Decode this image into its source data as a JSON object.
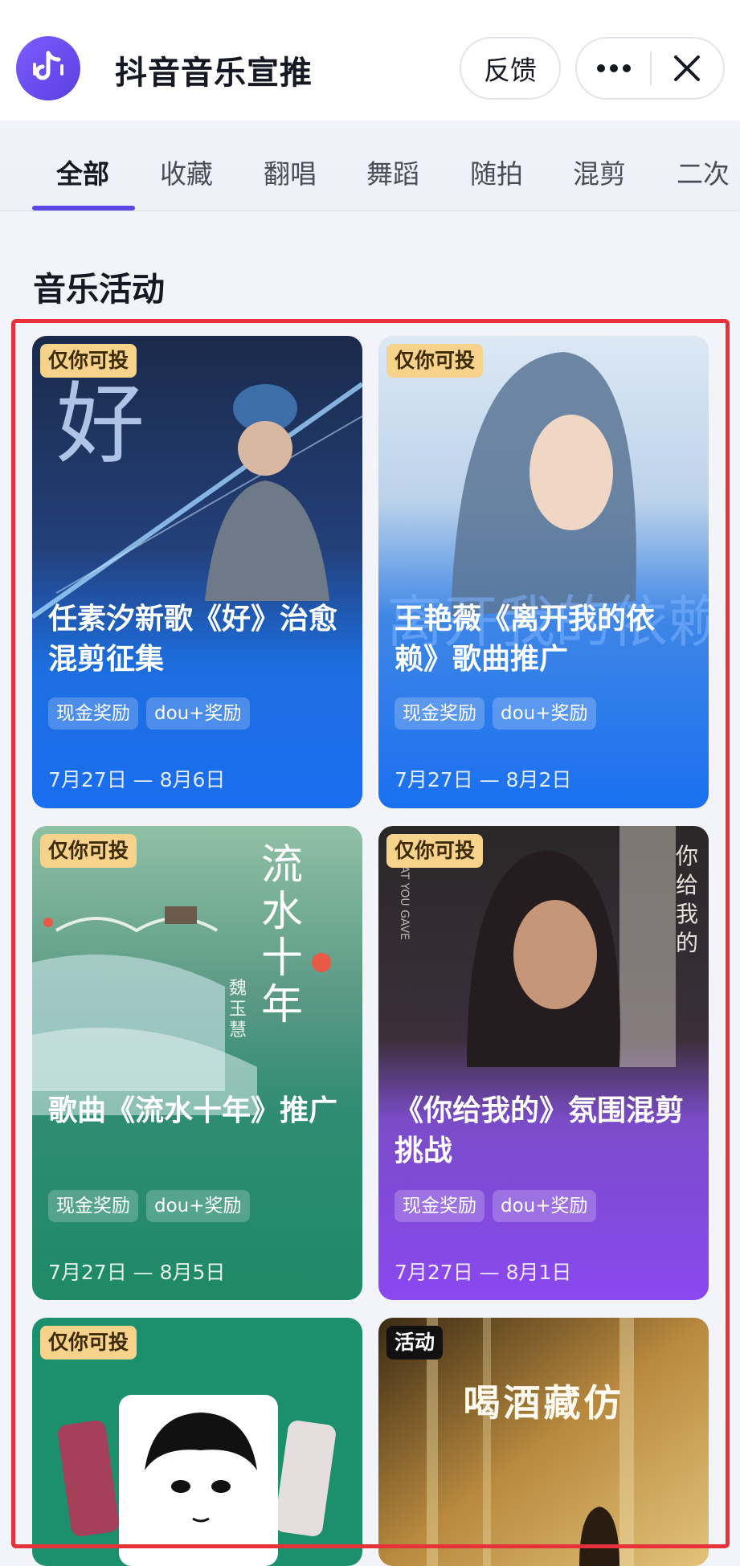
{
  "header": {
    "app_title": "抖音音乐宣推",
    "feedback_label": "反馈",
    "logo_icon": "douyin-music-logo-icon",
    "more_icon": "more-dots-icon",
    "close_icon": "close-icon"
  },
  "tabs": [
    {
      "label": "全部",
      "active": true
    },
    {
      "label": "收藏",
      "active": false
    },
    {
      "label": "翻唱",
      "active": false
    },
    {
      "label": "舞蹈",
      "active": false
    },
    {
      "label": "随拍",
      "active": false
    },
    {
      "label": "混剪",
      "active": false
    },
    {
      "label": "二次",
      "active": false
    }
  ],
  "section": {
    "title": "音乐活动"
  },
  "cards": [
    {
      "badge": "仅你可投",
      "title": "任素汐新歌《好》治愈混剪征集",
      "tags": [
        "现金奖励",
        "dou+奖励"
      ],
      "date": "7月27日 — 8月6日",
      "art_text": "好"
    },
    {
      "badge": "仅你可投",
      "title": "王艳薇《离开我的依赖》歌曲推广",
      "tags": [
        "现金奖励",
        "dou+奖励"
      ],
      "date": "7月27日 — 8月2日",
      "art_text": "离开我的依赖"
    },
    {
      "badge": "仅你可投",
      "title": "歌曲《流水十年》推广",
      "tags": [
        "现金奖励",
        "dou+奖励"
      ],
      "date": "7月27日 — 8月5日",
      "art_text": "流水十年",
      "art_sub": "魏玉慧"
    },
    {
      "badge": "仅你可投",
      "title": "《你给我的》氛围混剪挑战",
      "tags": [
        "现金奖励",
        "dou+奖励"
      ],
      "date": "7月27日 — 8月1日",
      "art_text": "你给我的",
      "art_sub": "THAT YOU GAVE"
    },
    {
      "badge": "仅你可投",
      "title": "",
      "tags": [],
      "date": ""
    },
    {
      "badge": "活动",
      "title": "",
      "tags": [],
      "date": "",
      "art_text": "喝酒藏仿"
    }
  ],
  "colors": {
    "accent": "#5b46e6",
    "badge_bg": "#f7d28a",
    "highlight": "#e8323a"
  }
}
